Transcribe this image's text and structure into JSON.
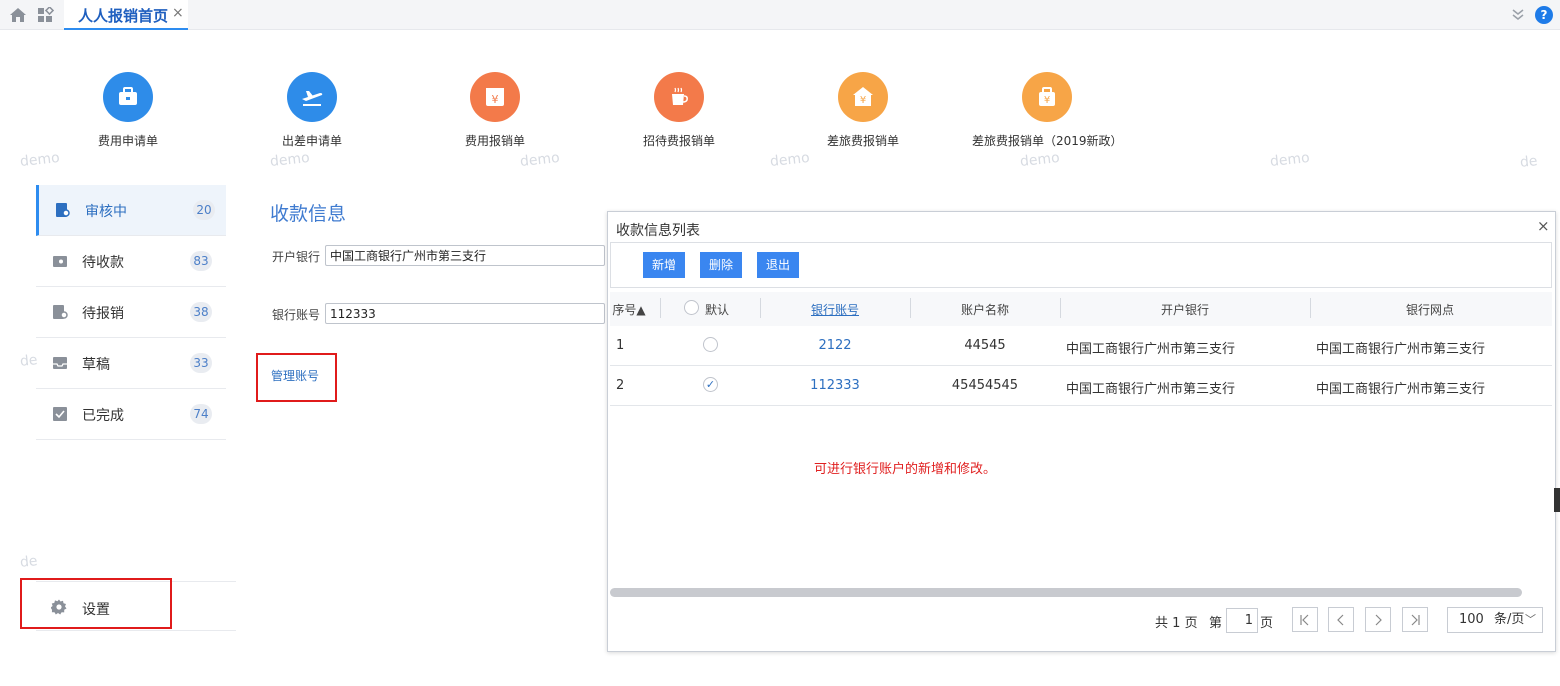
{
  "topbar": {
    "tab_label": "人人报销首页",
    "tab_close": "×",
    "help": "?"
  },
  "shortcuts": [
    {
      "label": "费用申请单",
      "icon": "briefcase-icon",
      "color": "#2e8ce9"
    },
    {
      "label": "出差申请单",
      "icon": "airplane-icon",
      "color": "#2e8ce9"
    },
    {
      "label": "费用报销单",
      "icon": "yen-box-icon",
      "color": "#f37a4a"
    },
    {
      "label": "招待费报销单",
      "icon": "coffee-cup-icon",
      "color": "#f37a4a"
    },
    {
      "label": "差旅费报销单",
      "icon": "yen-house-icon",
      "color": "#f7a547"
    },
    {
      "label": "差旅费报销单（2019新政）",
      "icon": "yen-bag-icon",
      "color": "#f7a547"
    }
  ],
  "watermark": {
    "text": "demo",
    "partial": "de"
  },
  "sidebar": {
    "items": [
      {
        "label": "审核中",
        "count": "20",
        "icon": "review-icon"
      },
      {
        "label": "待收款",
        "count": "83",
        "icon": "wallet-icon"
      },
      {
        "label": "待报销",
        "count": "38",
        "icon": "pending-doc-icon"
      },
      {
        "label": "草稿",
        "count": "33",
        "icon": "inbox-icon"
      },
      {
        "label": "已完成",
        "count": "74",
        "icon": "completed-icon"
      }
    ],
    "settings_label": "设置"
  },
  "form": {
    "title": "收款信息",
    "bank_label": "开户银行",
    "bank_value": "中国工商银行广州市第三支行",
    "account_label": "银行账号",
    "account_value": "112333",
    "manage_link": "管理账号"
  },
  "dialog": {
    "title": "收款信息列表",
    "close": "×",
    "buttons": {
      "add": "新增",
      "delete": "删除",
      "exit": "退出"
    },
    "columns": {
      "index": "序号▲",
      "default": "默认",
      "account": "银行账号",
      "name": "账户名称",
      "bank": "开户银行",
      "branch": "银行网点"
    },
    "rows": [
      {
        "index": "1",
        "checked": false,
        "check_mark": "",
        "account": "2122",
        "name": "44545",
        "bank": "中国工商银行广州市第三支行",
        "branch": "中国工商银行广州市第三支行"
      },
      {
        "index": "2",
        "checked": true,
        "check_mark": "✓",
        "account": "112333",
        "name": "45454545",
        "bank": "中国工商银行广州市第三支行",
        "branch": "中国工商银行广州市第三支行"
      }
    ],
    "hint": "可进行银行账户的新增和修改。",
    "pager": {
      "total_prefix": "共",
      "total_pages": "1",
      "total_suffix": "页",
      "page_prefix": "第",
      "page": "1",
      "page_suffix": "页",
      "page_size": "100",
      "page_size_unit": "条/页"
    }
  }
}
